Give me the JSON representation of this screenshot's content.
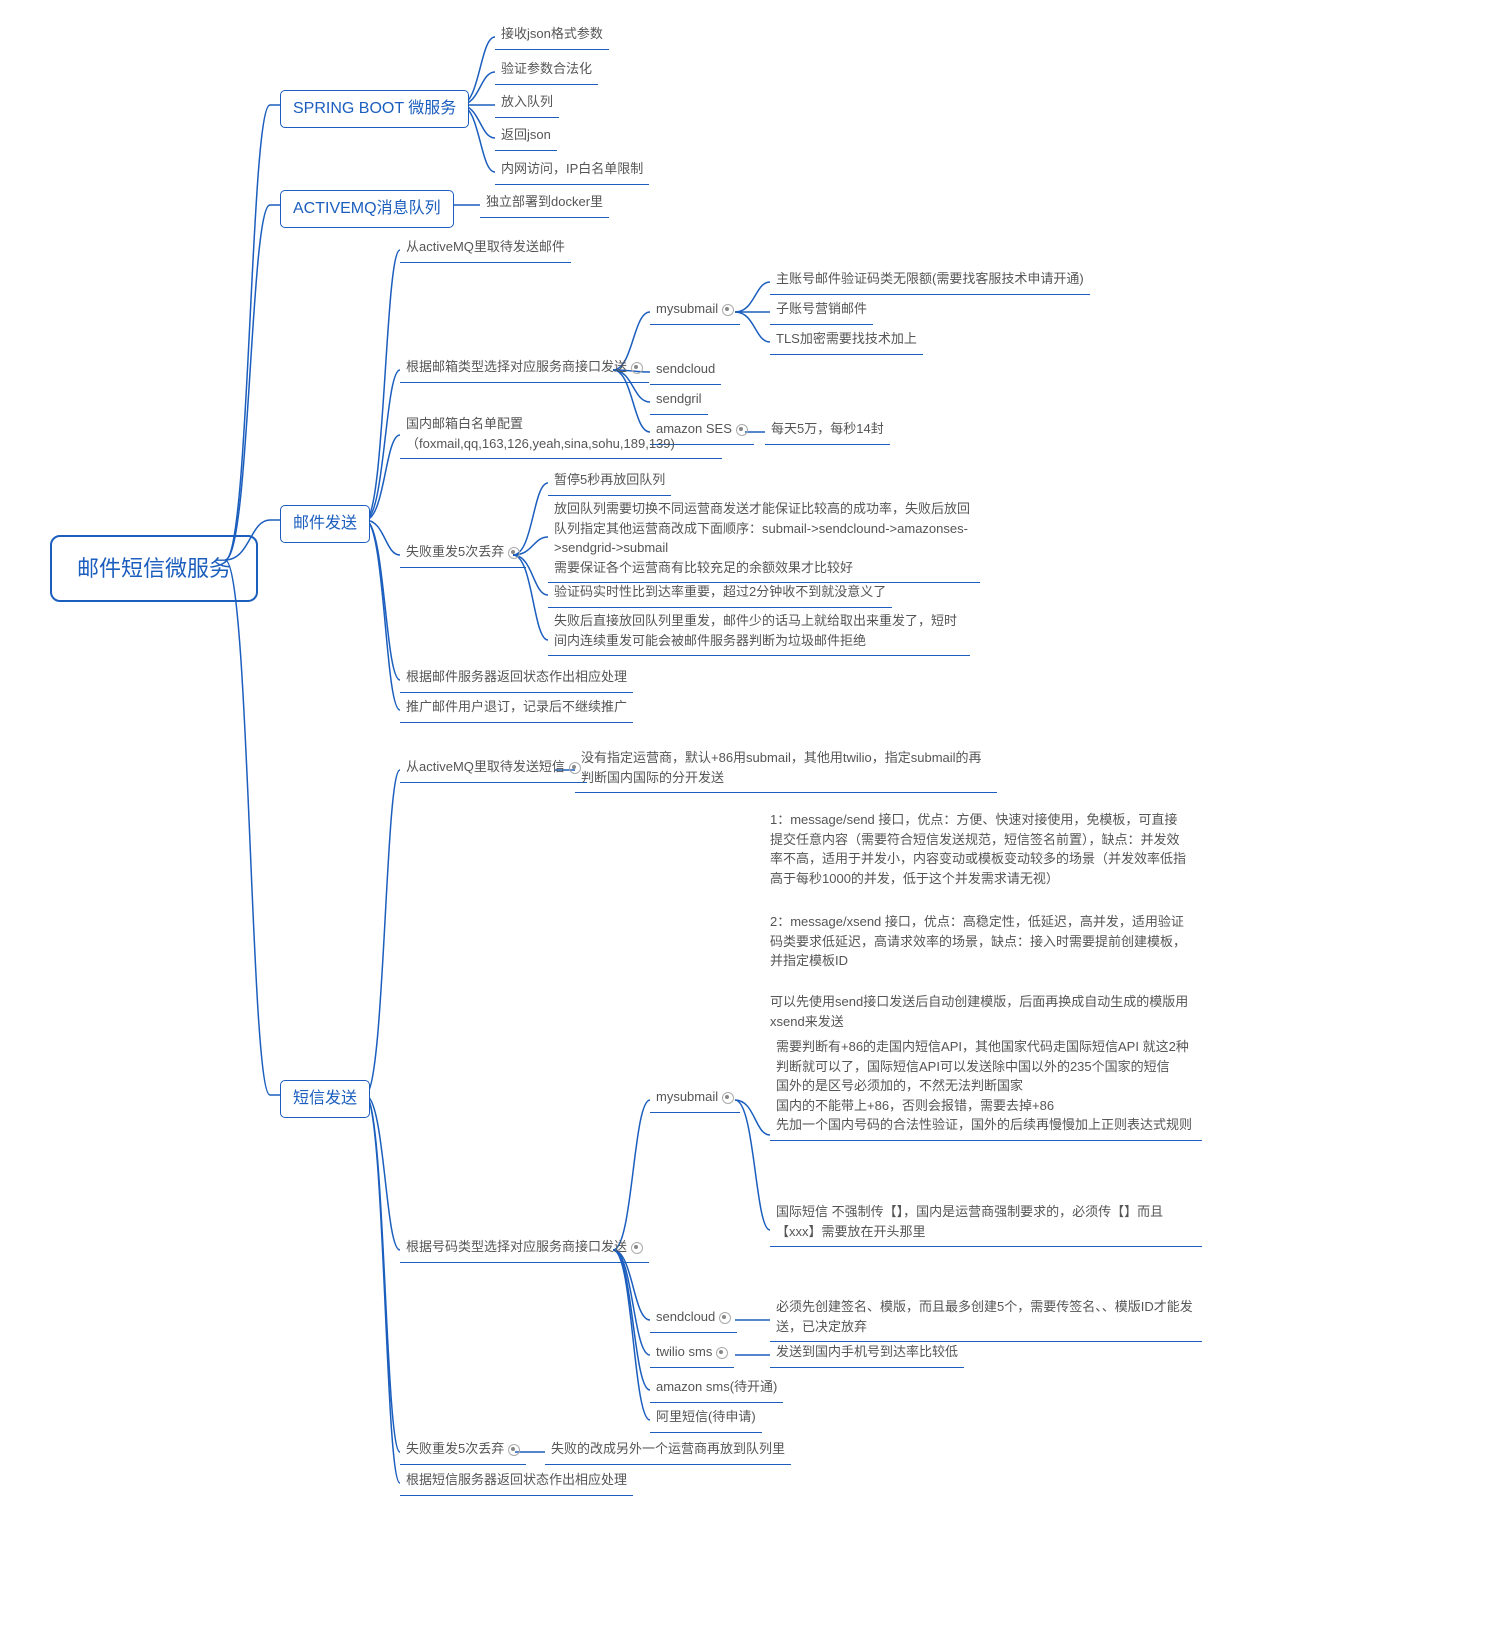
{
  "root": "邮件短信微服务",
  "spring": {
    "title": "SPRING BOOT 微服务",
    "items": [
      "接收json格式参数",
      "验证参数合法化",
      "放入队列",
      "返回json",
      "内网访问，IP白名单限制"
    ]
  },
  "amq": {
    "title": "ACTIVEMQ消息队列",
    "items": [
      "独立部署到docker里"
    ]
  },
  "mail": {
    "title": "邮件发送",
    "pull": "从activeMQ里取待发送邮件",
    "select": "根据邮箱类型选择对应服务商接口发送",
    "mysubmail": {
      "label": "mysubmail",
      "items": [
        "主账号邮件验证码类无限额(需要找客服技术申请开通)",
        "子账号营销邮件",
        "TLS加密需要找技术加上"
      ]
    },
    "sendcloud": "sendcloud",
    "sendgril": "sendgril",
    "ses": {
      "label": "amazon SES",
      "note": "每天5万，每秒14封"
    },
    "whitelist": "国内邮箱白名单配置（foxmail,qq,163,126,yeah,sina,sohu,189,139)",
    "retry": {
      "label": "失败重发5次丢弃",
      "items": [
        "暂停5秒再放回队列",
        "放回队列需要切换不同运营商发送才能保证比较高的成功率，失败后放回队列指定其他运营商改成下面顺序：submail->sendclound->amazonses->sendgrid->submail\n需要保证各个运营商有比较充足的余额效果才比较好",
        "验证码实时性比到达率重要，超过2分钟收不到就没意义了",
        "失败后直接放回队列里重发，邮件少的话马上就给取出来重发了，短时间内连续重发可能会被邮件服务器判断为垃圾邮件拒绝"
      ]
    },
    "status": "根据邮件服务器返回状态作出相应处理",
    "unsub": "推广邮件用户退订，记录后不继续推广"
  },
  "sms": {
    "title": "短信发送",
    "pull": {
      "label": "从activeMQ里取待发送短信",
      "note": "没有指定运营商，默认+86用submail，其他用twilio，指定submail的再判断国内国际的分开发送"
    },
    "select": "根据号码类型选择对应服务商接口发送",
    "mysubmail": {
      "label": "mysubmail",
      "notes": [
        "1：message/send 接口，优点：方便、快速对接使用，免模板，可直接提交任意内容（需要符合短信发送规范，短信签名前置），缺点：并发效率不高，适用于并发小，内容变动或模板变动较多的场景（并发效率低指高于每秒1000的并发，低于这个并发需求请无视）",
        "2：message/xsend 接口，优点：高稳定性，低延迟，高并发，适用验证码类要求低延迟，高请求效率的场景，缺点：接入时需要提前创建模板，并指定模板ID",
        "可以先使用send接口发送后自动创建模版，后面再换成自动生成的模版用xsend来发送"
      ],
      "items": [
        "需要判断有+86的走国内短信API，其他国家代码走国际短信API  就这2种判断就可以了，国际短信API可以发送除中国以外的235个国家的短信\n国外的是区号必须加的，不然无法判断国家\n国内的不能带上+86，否则会报错，需要去掉+86\n先加一个国内号码的合法性验证，国外的后续再慢慢加上正则表达式规则",
        "国际短信 不强制传【】，国内是运营商强制要求的，必须传【】而且【xxx】需要放在开头那里"
      ]
    },
    "sendcloud": {
      "label": "sendcloud",
      "note": "必须先创建签名、模版，而且最多创建5个，需要传签名、、模版ID才能发送，已决定放弃"
    },
    "twilio": {
      "label": "twilio sms",
      "note": "发送到国内手机号到达率比较低"
    },
    "amazon": "amazon sms(待开通)",
    "ali": "阿里短信(待申请)",
    "retry": {
      "label": "失败重发5次丢弃",
      "note": "失败的改成另外一个运营商再放到队列里"
    },
    "status": "根据短信服务器返回状态作出相应处理"
  }
}
